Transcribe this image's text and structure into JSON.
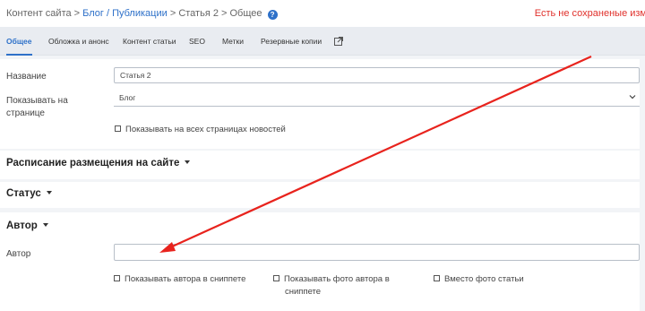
{
  "breadcrumb": {
    "root": "Контент сайта",
    "sep1": " > ",
    "section": "Блог / Публикации",
    "sep2": " > ",
    "item": "Статья 2",
    "sep3": " > ",
    "current": "Общее"
  },
  "unsaved_notice": "Есть не сохраненые изм",
  "tabs": [
    {
      "label": "Общее",
      "active": true
    },
    {
      "label": "Обложка и анонс"
    },
    {
      "label": "Контент статьи"
    },
    {
      "label": "SEO"
    },
    {
      "label": "Метки"
    },
    {
      "label": "Резервные копии"
    }
  ],
  "general": {
    "name_label": "Название",
    "name_value": "Статья 2",
    "page_label_line1": "Показывать на",
    "page_label_line2": "странице",
    "page_value": "Блог",
    "all_news_checkbox": "Показывать на всех страницах новостей"
  },
  "sections": {
    "schedule": "Расписание размещения на сайте",
    "status": "Статус",
    "author": "Автор"
  },
  "author": {
    "field_label": "Автор",
    "field_value": "",
    "cb_snippet": "Показывать автора в сниппете",
    "cb_photo_line1": "Показывать фото автора в",
    "cb_photo_line2": "сниппете",
    "cb_instead": "Вместо фото статьи"
  },
  "colors": {
    "accent": "#2e71c9",
    "warning": "#e0302b",
    "annotation_arrow": "#e8231d"
  }
}
